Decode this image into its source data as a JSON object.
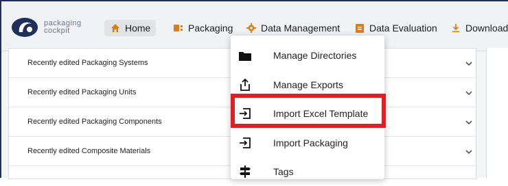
{
  "app": {
    "logo_text_line1": "packaging",
    "logo_text_line2": "cockpit"
  },
  "nav": {
    "home": "Home",
    "packaging": "Packaging",
    "data_management": "Data Management",
    "data_evaluation": "Data Evaluation",
    "downloads": "Downloads"
  },
  "panels": [
    {
      "label": "Recently edited Packaging Systems"
    },
    {
      "label": "Recently edited Packaging Units"
    },
    {
      "label": "Recently edited Packaging Components"
    },
    {
      "label": "Recently edited Composite Materials"
    }
  ],
  "dropdown": {
    "items": [
      {
        "label": "Manage Directories",
        "icon": "folder-icon"
      },
      {
        "label": "Manage Exports",
        "icon": "export-icon"
      },
      {
        "label": "Import Excel Template",
        "icon": "import-icon",
        "highlighted": true
      },
      {
        "label": "Import Packaging",
        "icon": "import-icon"
      },
      {
        "label": "Tags",
        "icon": "signpost-icon"
      }
    ]
  },
  "colors": {
    "brand": "#1f2f5a",
    "highlight": "#e11e24",
    "navbar_bg": "#f1f2f4"
  }
}
